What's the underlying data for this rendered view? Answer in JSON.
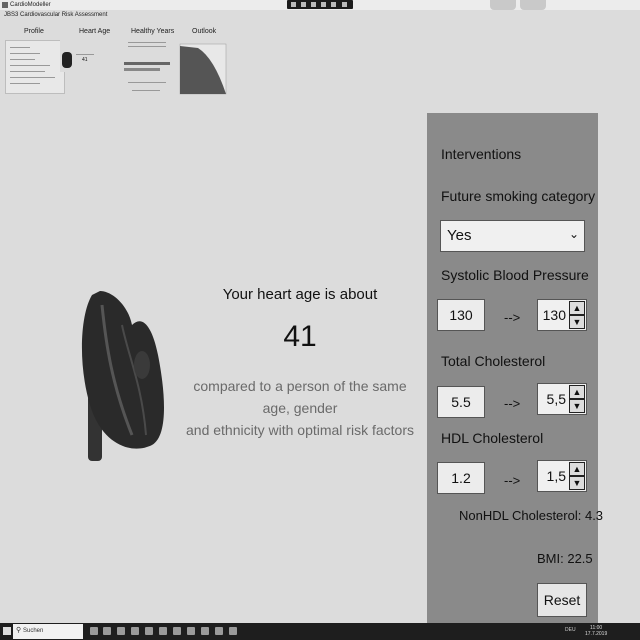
{
  "window": {
    "title": "CardioModeller",
    "subtitle": "JBS3 Cardiovascular Risk Assessment"
  },
  "tabs": [
    {
      "label": "Profile"
    },
    {
      "label": "Heart Age"
    },
    {
      "label": "Healthy Years"
    },
    {
      "label": "Outlook"
    }
  ],
  "main": {
    "heading": "Your heart age is about",
    "heart_age": "41",
    "description_line1": "compared to a person of the same age, gender",
    "description_line2": "and ethnicity with optimal risk factors"
  },
  "interventions": {
    "title": "Interventions",
    "smoking_label": "Future smoking category",
    "smoking_value": "Yes",
    "sbp_label": "Systolic Blood Pressure",
    "sbp_current": "130",
    "sbp_arrow": "-->",
    "sbp_target": "130",
    "tc_label": "Total Cholesterol",
    "tc_current": "5.5",
    "tc_arrow": "-->",
    "tc_target": "5,5",
    "hdl_label": "HDL Cholesterol",
    "hdl_current": "1.2",
    "hdl_arrow": "-->",
    "hdl_target": "1,5",
    "nonhdl": "NonHDL Cholesterol: 4.3",
    "bmi": "BMI: 22.5",
    "reset_label": "Reset"
  },
  "taskbar": {
    "search_placeholder": "Suchen",
    "lang": "DEU",
    "time": "11:00",
    "date": "17.7.2019"
  },
  "colors": {
    "panel_bg": "#8a8a8a",
    "page_bg": "#dcdcdc",
    "taskbar_bg": "#1e1e1e"
  }
}
